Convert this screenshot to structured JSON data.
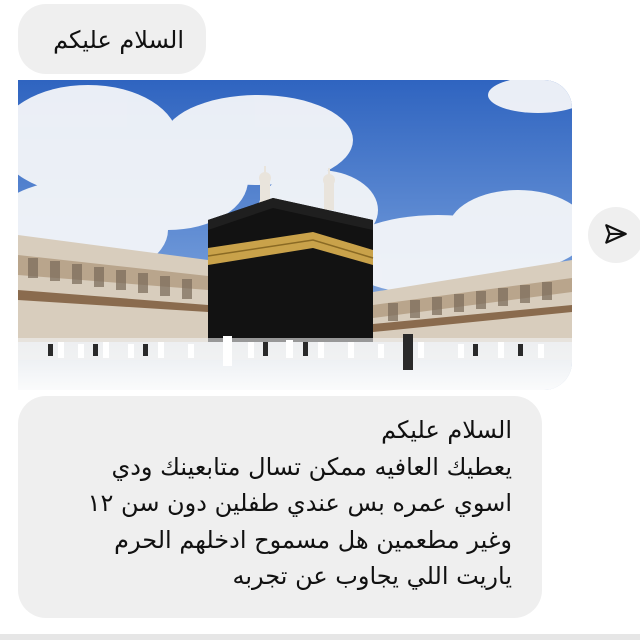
{
  "chat": {
    "greeting_message": "السلام عليكم",
    "image_message": {
      "icon": "kaaba-photo",
      "description_icon": "kaaba-photo"
    },
    "question_message": {
      "lines": [
        "السلام عليكم",
        "يعطيك العافيه ممكن تسال متابعينك ودي",
        "اسوي عمره بس عندي طفلين دون سن ١٢",
        "وغير مطعمين هل مسموح ادخلهم الحرم",
        "ياريت اللي يجاوب عن تجربه"
      ]
    }
  },
  "actions": {
    "share_icon": "send-arrow-icon"
  },
  "colors": {
    "bubble": "#efefef",
    "text": "#111111",
    "sky": "#3f74c8",
    "kaaba": "#111111",
    "kiswa_band": "#c9a24a"
  }
}
